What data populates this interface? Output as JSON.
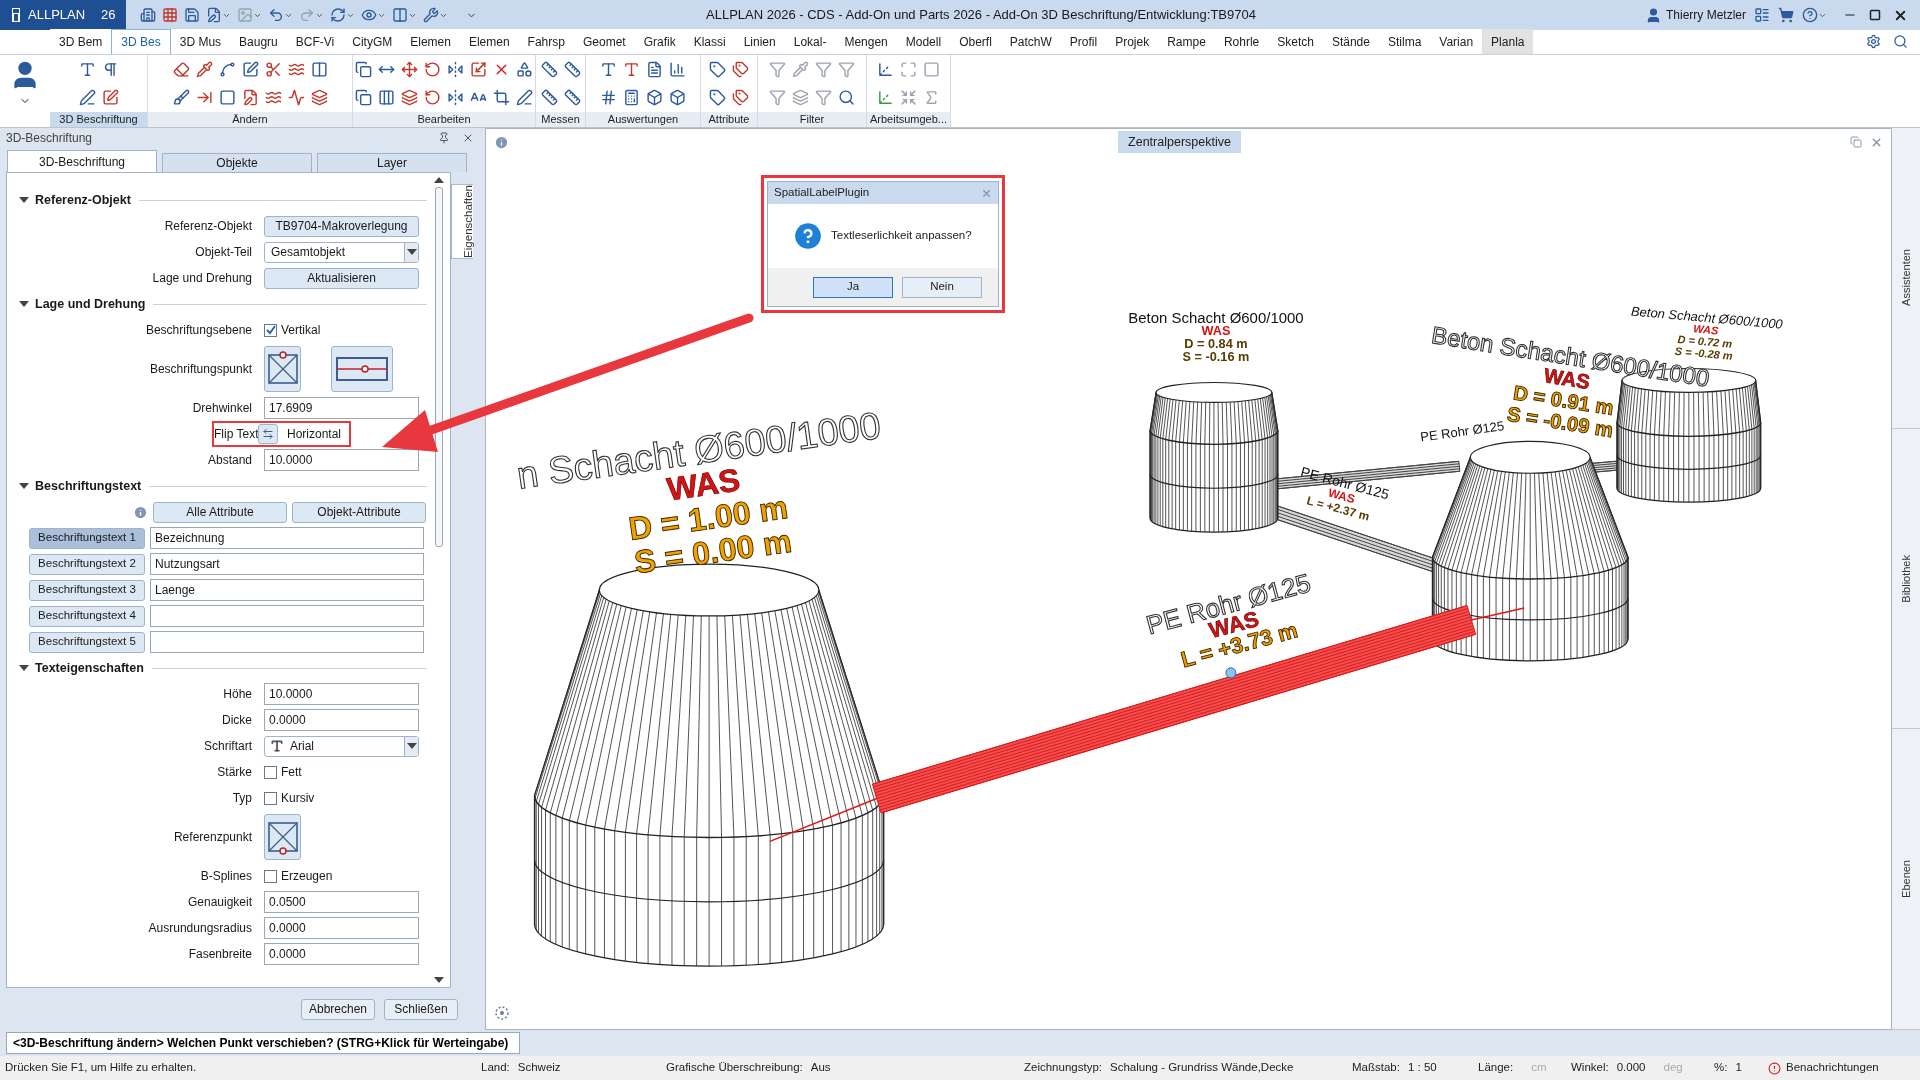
{
  "title_bar": {
    "app_name": "ALLPLAN",
    "version": "26",
    "title": "ALLPLAN 2026 - CDS - Add-On und Parts 2026 - Add-On 3D Beschriftung/Entwicklung:TB9704",
    "user": "Thierry Metzler"
  },
  "ribbon": {
    "tabs": [
      {
        "label": "3D Bem",
        "selected": false,
        "highlighted": false
      },
      {
        "label": "3D Bes",
        "selected": true,
        "highlighted": false
      },
      {
        "label": "3D Mus",
        "selected": false,
        "highlighted": false
      },
      {
        "label": "Baugru",
        "selected": false,
        "highlighted": false
      },
      {
        "label": "BCF-Vi",
        "selected": false,
        "highlighted": false
      },
      {
        "label": "CityGM",
        "selected": false,
        "highlighted": false
      },
      {
        "label": "Elemen",
        "selected": false,
        "highlighted": false
      },
      {
        "label": "Elemen",
        "selected": false,
        "highlighted": false
      },
      {
        "label": "Fahrsp",
        "selected": false,
        "highlighted": false
      },
      {
        "label": "Geomet",
        "selected": false,
        "highlighted": false
      },
      {
        "label": "Grafik",
        "selected": false,
        "highlighted": false
      },
      {
        "label": "Klassi",
        "selected": false,
        "highlighted": false
      },
      {
        "label": "Linien",
        "selected": false,
        "highlighted": false
      },
      {
        "label": "Lokal-",
        "selected": false,
        "highlighted": false
      },
      {
        "label": "Mengen",
        "selected": false,
        "highlighted": false
      },
      {
        "label": "Modell",
        "selected": false,
        "highlighted": false
      },
      {
        "label": "Oberfl",
        "selected": false,
        "highlighted": false
      },
      {
        "label": "PatchW",
        "selected": false,
        "highlighted": false
      },
      {
        "label": "Profil",
        "selected": false,
        "highlighted": false
      },
      {
        "label": "Projek",
        "selected": false,
        "highlighted": false
      },
      {
        "label": "Rampe",
        "selected": false,
        "highlighted": false
      },
      {
        "label": "Rohrle",
        "selected": false,
        "highlighted": false
      },
      {
        "label": "Sketch",
        "selected": false,
        "highlighted": false
      },
      {
        "label": "Stände",
        "selected": false,
        "highlighted": false
      },
      {
        "label": "Stilma",
        "selected": false,
        "highlighted": false
      },
      {
        "label": "Varian",
        "selected": false,
        "highlighted": false
      },
      {
        "label": "Planla",
        "selected": false,
        "highlighted": true
      }
    ],
    "groups": [
      {
        "label": "3D Beschriftung",
        "selected": true
      },
      {
        "label": "Ändern",
        "selected": false
      },
      {
        "label": "Bearbeiten",
        "selected": false
      },
      {
        "label": "Messen",
        "selected": false
      },
      {
        "label": "Auswertungen",
        "selected": false
      },
      {
        "label": "Attribute",
        "selected": false
      },
      {
        "label": "Filter",
        "selected": false
      },
      {
        "label": "Arbeitsumgeb...",
        "selected": false
      }
    ]
  },
  "panel": {
    "title": "3D-Beschriftung",
    "tabs": [
      {
        "label": "3D-Beschriftung",
        "selected": true
      },
      {
        "label": "Objekte",
        "selected": false
      },
      {
        "label": "Layer",
        "selected": false
      }
    ],
    "side_tab": "Eigenschaften",
    "sections": [
      {
        "title": "Referenz-Objekt",
        "expanded": true,
        "rows": [
          {
            "kind": "button",
            "label": "Referenz-Objekt",
            "value": "TB9704-Makroverlegung"
          },
          {
            "kind": "dropdown",
            "label": "Objekt-Teil",
            "value": "Gesamtobjekt"
          },
          {
            "kind": "button",
            "label": "Lage und Drehung",
            "value": "Aktualisieren"
          }
        ]
      },
      {
        "title": "Lage und Drehung",
        "expanded": true,
        "rows": [
          {
            "kind": "checkbox",
            "label": "Beschriftungsebene",
            "text": "Vertikal",
            "checked": true
          },
          {
            "kind": "anchor",
            "label": "Beschriftungspunkt",
            "marker_at_top": true,
            "with_line": true
          },
          {
            "kind": "field",
            "label": "Drehwinkel",
            "value": "17.6909"
          },
          {
            "kind": "toggle",
            "label": "Flip Text",
            "value": "Horizontal",
            "highlighted": true
          },
          {
            "kind": "field",
            "label": "Abstand",
            "value": "10.0000"
          }
        ]
      },
      {
        "title": "Beschriftungstext",
        "expanded": true,
        "rows": [
          {
            "kind": "attribute_buttons",
            "buttons": [
              "Alle Attribute",
              "Objekt-Attribute"
            ]
          },
          {
            "kind": "slot",
            "label": "Beschriftungstext 1",
            "value": "Bezeichnung",
            "selected": true
          },
          {
            "kind": "slot",
            "label": "Beschriftungstext 2",
            "value": "Nutzungsart",
            "selected": false
          },
          {
            "kind": "slot",
            "label": "Beschriftungstext 3",
            "value": "Laenge",
            "selected": false
          },
          {
            "kind": "slot",
            "label": "Beschriftungstext 4",
            "selected": false
          },
          {
            "kind": "slot",
            "label": "Beschriftungstext 5",
            "selected": false
          }
        ]
      },
      {
        "title": "Texteigenschaften",
        "expanded": true,
        "rows": [
          {
            "kind": "field",
            "label": "Höhe",
            "value": "10.0000"
          },
          {
            "kind": "field",
            "label": "Dicke",
            "value": "0.0000"
          },
          {
            "kind": "font",
            "label": "Schriftart",
            "value": "Arial"
          },
          {
            "kind": "checkbox",
            "label": "Stärke",
            "text": "Fett",
            "checked": false
          },
          {
            "kind": "checkbox",
            "label": "Typ",
            "text": "Kursiv",
            "checked": false
          },
          {
            "kind": "anchor",
            "label": "Referenzpunkt",
            "marker_at_top": false,
            "with_line": false
          },
          {
            "kind": "checkbox",
            "label": "B-Splines",
            "text": "Erzeugen",
            "checked": false
          },
          {
            "kind": "field",
            "label": "Genauigkeit",
            "value": "0.0500"
          },
          {
            "kind": "field",
            "label": "Ausrundungsradius",
            "value": "0.0000"
          },
          {
            "kind": "field",
            "label": "Fasenbreite",
            "value": "0.0000"
          }
        ]
      }
    ],
    "buttons": [
      "Abbrechen",
      "Schließen"
    ]
  },
  "viewport": {
    "title": "Zentralperspektive",
    "labels": [
      {
        "lines": [
          {
            "kind": "name",
            "text": "n Schacht Ø600/1000"
          },
          {
            "kind": "utility",
            "text": "WAS"
          },
          {
            "kind": "value",
            "text": "D = 1.00 m"
          },
          {
            "kind": "value",
            "text": "S = 0.00 m"
          }
        ]
      },
      {
        "lines": [
          {
            "kind": "name",
            "text": "Beton Schacht Ø600/1000"
          },
          {
            "kind": "utility",
            "text": "WAS"
          },
          {
            "kind": "value",
            "text": "D = 0.84 m"
          },
          {
            "kind": "value",
            "text": "S = -0.16 m"
          }
        ]
      },
      {
        "lines": [
          {
            "kind": "name",
            "text": "Beton Schacht Ø600/1000"
          },
          {
            "kind": "utility",
            "text": "WAS"
          },
          {
            "kind": "value",
            "text": "D = 0.91 m"
          },
          {
            "kind": "value",
            "text": "S = -0.09 m"
          }
        ]
      },
      {
        "lines": [
          {
            "kind": "name",
            "text": "Beton Schacht Ø600/1000"
          },
          {
            "kind": "utility",
            "text": "WAS"
          },
          {
            "kind": "value",
            "text": "D = 0.72 m"
          },
          {
            "kind": "value",
            "text": "S = -0.28 m"
          }
        ]
      },
      {
        "lines": [
          {
            "kind": "name",
            "text": "PE Rohr Ø125"
          },
          {
            "kind": "utility",
            "text": "WAS"
          },
          {
            "kind": "value",
            "text": "L = +3.73 m"
          }
        ]
      },
      {
        "lines": [
          {
            "kind": "name",
            "text": "PE Rohr Ø125"
          },
          {
            "kind": "utility",
            "text": "WAS"
          },
          {
            "kind": "value",
            "text": "L = +2.37 m"
          }
        ]
      },
      {
        "lines": [
          {
            "kind": "name",
            "text": "PE Rohr Ø125"
          }
        ]
      }
    ],
    "dialog": {
      "title": "SpatialLabelPlugin",
      "message": "Textleserlichkeit anpassen?",
      "highlighted": true,
      "buttons": [
        {
          "label": "Ja",
          "default": true
        },
        {
          "label": "Nein",
          "default": false
        }
      ]
    },
    "side_tabs": [
      "Assistenten",
      "Bibliothek",
      "Ebenen"
    ]
  },
  "command_line": "<3D-Beschriftung ändern> Welchen Punkt verschieben? (STRG+Klick für Werteingabe)",
  "status_bar": {
    "help": "Drücken Sie F1, um Hilfe zu erhalten.",
    "items": [
      {
        "label": "Land:",
        "value": "Schweiz"
      },
      {
        "label": "Grafische Überschreibung:",
        "value": "Aus"
      },
      {
        "label": "Zeichnungstyp:",
        "value": "Schalung  -  Grundriss Wände,Decke"
      },
      {
        "label": "Maßstab:",
        "value": "1 : 50"
      },
      {
        "label": "Länge:",
        "unit": "cm"
      },
      {
        "label": "Winkel:",
        "value": "0.000",
        "unit": "deg"
      },
      {
        "label": "%:",
        "value": "1"
      }
    ],
    "notifications": "Benachrichtungen"
  }
}
